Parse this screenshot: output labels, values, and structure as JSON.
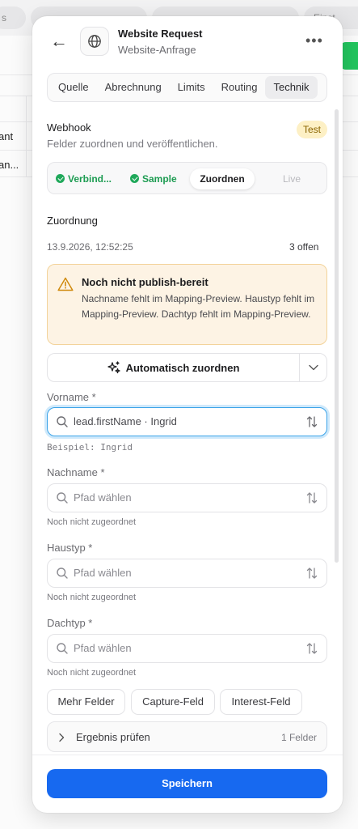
{
  "background": {
    "tabs": [
      "s",
      "",
      "",
      "Einst"
    ],
    "cells": [
      "ant",
      "an..."
    ]
  },
  "header": {
    "back_icon": "arrow-left-icon",
    "app_icon": "globe-icon",
    "title": "Website Request",
    "subtitle": "Website-Anfrage",
    "more_icon": "more-horizontal-icon"
  },
  "tabs": [
    {
      "label": "Quelle",
      "active": false
    },
    {
      "label": "Abrechnung",
      "active": false
    },
    {
      "label": "Limits",
      "active": false
    },
    {
      "label": "Routing",
      "active": false
    },
    {
      "label": "Technik",
      "active": true
    }
  ],
  "section": {
    "title": "Webhook",
    "subtitle": "Felder zuordnen und veröffentlichen.",
    "badge": "Test"
  },
  "steps": [
    {
      "label": "Verbind...",
      "state": "done"
    },
    {
      "label": "Sample",
      "state": "done"
    },
    {
      "label": "Zuordnen",
      "state": "current"
    },
    {
      "label": "Live",
      "state": "disabled"
    }
  ],
  "mapping": {
    "title": "Zuordnung",
    "timestamp": "13.9.2026, 12:52:25",
    "open_count": "3 offen"
  },
  "warning": {
    "title": "Noch nicht publish-bereit",
    "body": "Nachname fehlt im Mapping-Preview. Haustyp fehlt im Mapping-Preview. Dachtyp fehlt im Mapping-Preview."
  },
  "auto_map": {
    "label": "Automatisch zuordnen",
    "icon": "sparkles-icon",
    "dropdown_icon": "chevron-down-icon"
  },
  "fields": [
    {
      "label": "Vorname *",
      "value": "lead.firstName · Ingrid",
      "hint": "Beispiel: Ingrid",
      "focused": true
    },
    {
      "label": "Nachname *",
      "value": "Pfad wählen",
      "hint": "Noch nicht zugeordnet",
      "focused": false
    },
    {
      "label": "Haustyp *",
      "value": "Pfad wählen",
      "hint": "Noch nicht zugeordnet",
      "focused": false
    },
    {
      "label": "Dachtyp *",
      "value": "Pfad wählen",
      "hint": "Noch nicht zugeordnet",
      "focused": false
    }
  ],
  "chips": [
    "Mehr Felder",
    "Capture-Feld",
    "Interest-Feld"
  ],
  "result": {
    "label": "Ergebnis prüfen",
    "count": "1 Felder"
  },
  "footer": {
    "save_label": "Speichern"
  },
  "colors": {
    "accent": "#1769f0",
    "success": "#1d9c52",
    "warning_bg": "#fdf3e4",
    "badge_bg": "#fdf0c5"
  }
}
